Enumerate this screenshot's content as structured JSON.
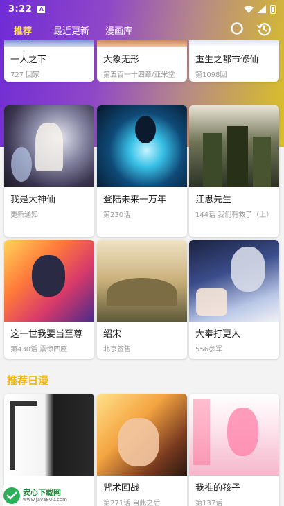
{
  "status_bar": {
    "time": "3:22",
    "notification_glyph": "A",
    "icons": [
      "wifi-icon",
      "signal-icon",
      "battery-icon"
    ]
  },
  "nav": {
    "tabs": [
      {
        "label": "推荐",
        "active": true
      },
      {
        "label": "最近更新",
        "active": false
      },
      {
        "label": "漫画库",
        "active": false
      }
    ],
    "icons": [
      "search-icon",
      "history-icon"
    ]
  },
  "colors": {
    "gradient_start": "#6f2bd6",
    "gradient_end": "#d9c124",
    "active_tab": "#ffe14a",
    "section_title": "#f2b900"
  },
  "recommended": [
    {
      "title": "一人之下",
      "subtitle": "727 回家"
    },
    {
      "title": "大象无形",
      "subtitle": "第五百一十四章/亚米堂主中"
    },
    {
      "title": "重生之都市修仙",
      "subtitle": "第1098回"
    },
    {
      "title": "我是大神仙",
      "subtitle": "更新通知"
    },
    {
      "title": "登陆未来一万年",
      "subtitle": "第230话"
    },
    {
      "title": "江思先生",
      "subtitle": "144话 我们有救了（上）"
    },
    {
      "title": "这一世我要当至尊",
      "subtitle": "第430话 震惊四座"
    },
    {
      "title": "绍宋",
      "subtitle": "北京签售"
    },
    {
      "title": "大奉打更人",
      "subtitle": "556参军"
    }
  ],
  "japanese_section": {
    "title": "推荐日漫",
    "items": [
      {
        "title": "",
        "subtitle": ""
      },
      {
        "title": "咒术回战",
        "subtitle": "第271话 自此之后"
      },
      {
        "title": "我推的孩子",
        "subtitle": "第137话"
      }
    ]
  },
  "watermark": {
    "name": "安心下载网",
    "url": "www.java800.com"
  }
}
